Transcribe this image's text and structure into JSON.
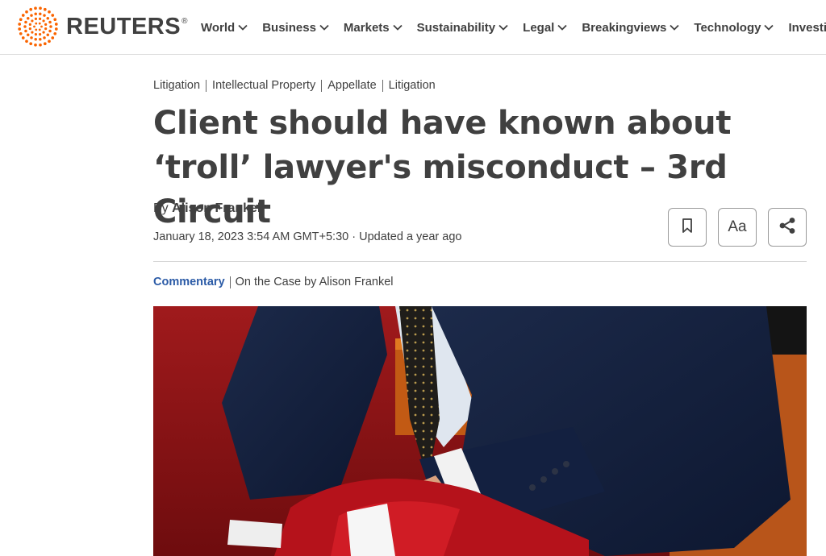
{
  "brand": {
    "name": "REUTERS",
    "registered": "®",
    "accent": "#fa6400"
  },
  "nav": {
    "items": [
      {
        "label": "World"
      },
      {
        "label": "Business"
      },
      {
        "label": "Markets"
      },
      {
        "label": "Sustainability"
      },
      {
        "label": "Legal"
      },
      {
        "label": "Breakingviews"
      },
      {
        "label": "Technology"
      },
      {
        "label": "Investigat"
      }
    ]
  },
  "article": {
    "breadcrumbs": [
      "Litigation",
      "Intellectual Property",
      "Appellate",
      "Litigation"
    ],
    "headline": "Client should have known about ‘troll’ lawyer's misconduct – 3rd Circuit",
    "byline_prefix": "By",
    "author": "Alison Frankel",
    "dateline": "January 18, 2023 3:54 AM GMT+5:30 · Updated a year ago",
    "actions": {
      "bookmark_icon": "bookmark-icon",
      "text_size_label": "Aa",
      "share_icon": "share-icon"
    },
    "kicker_label": "Commentary",
    "kicker_text": "On the Case by Alison Frankel",
    "kicker_color": "#2a5aa6"
  }
}
